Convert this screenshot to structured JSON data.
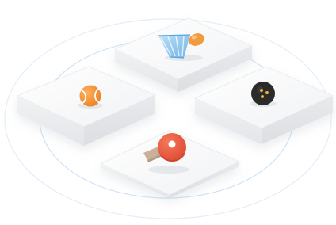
{
  "illustration": {
    "tiles": [
      {
        "icon": "badminton-shuttlecock-icon"
      },
      {
        "icon": "tennis-ball-icon"
      },
      {
        "icon": "squash-ball-icon"
      },
      {
        "icon": "table-tennis-paddle-icon"
      }
    ],
    "colors": {
      "orbit_ring": "#cfe3f5",
      "tile_top": "#f6f6f7",
      "tile_side": "#e9eaec",
      "shuttle_feathers": "#8fc6ee",
      "shuttle_cork": "#f39a3d",
      "tennis_ball": "#f08a2a",
      "squash_ball": "#2b2b2b",
      "squash_dots": "#f2b233",
      "paddle_blade": "#e85a3a",
      "paddle_handle": "#c9b09a"
    }
  }
}
